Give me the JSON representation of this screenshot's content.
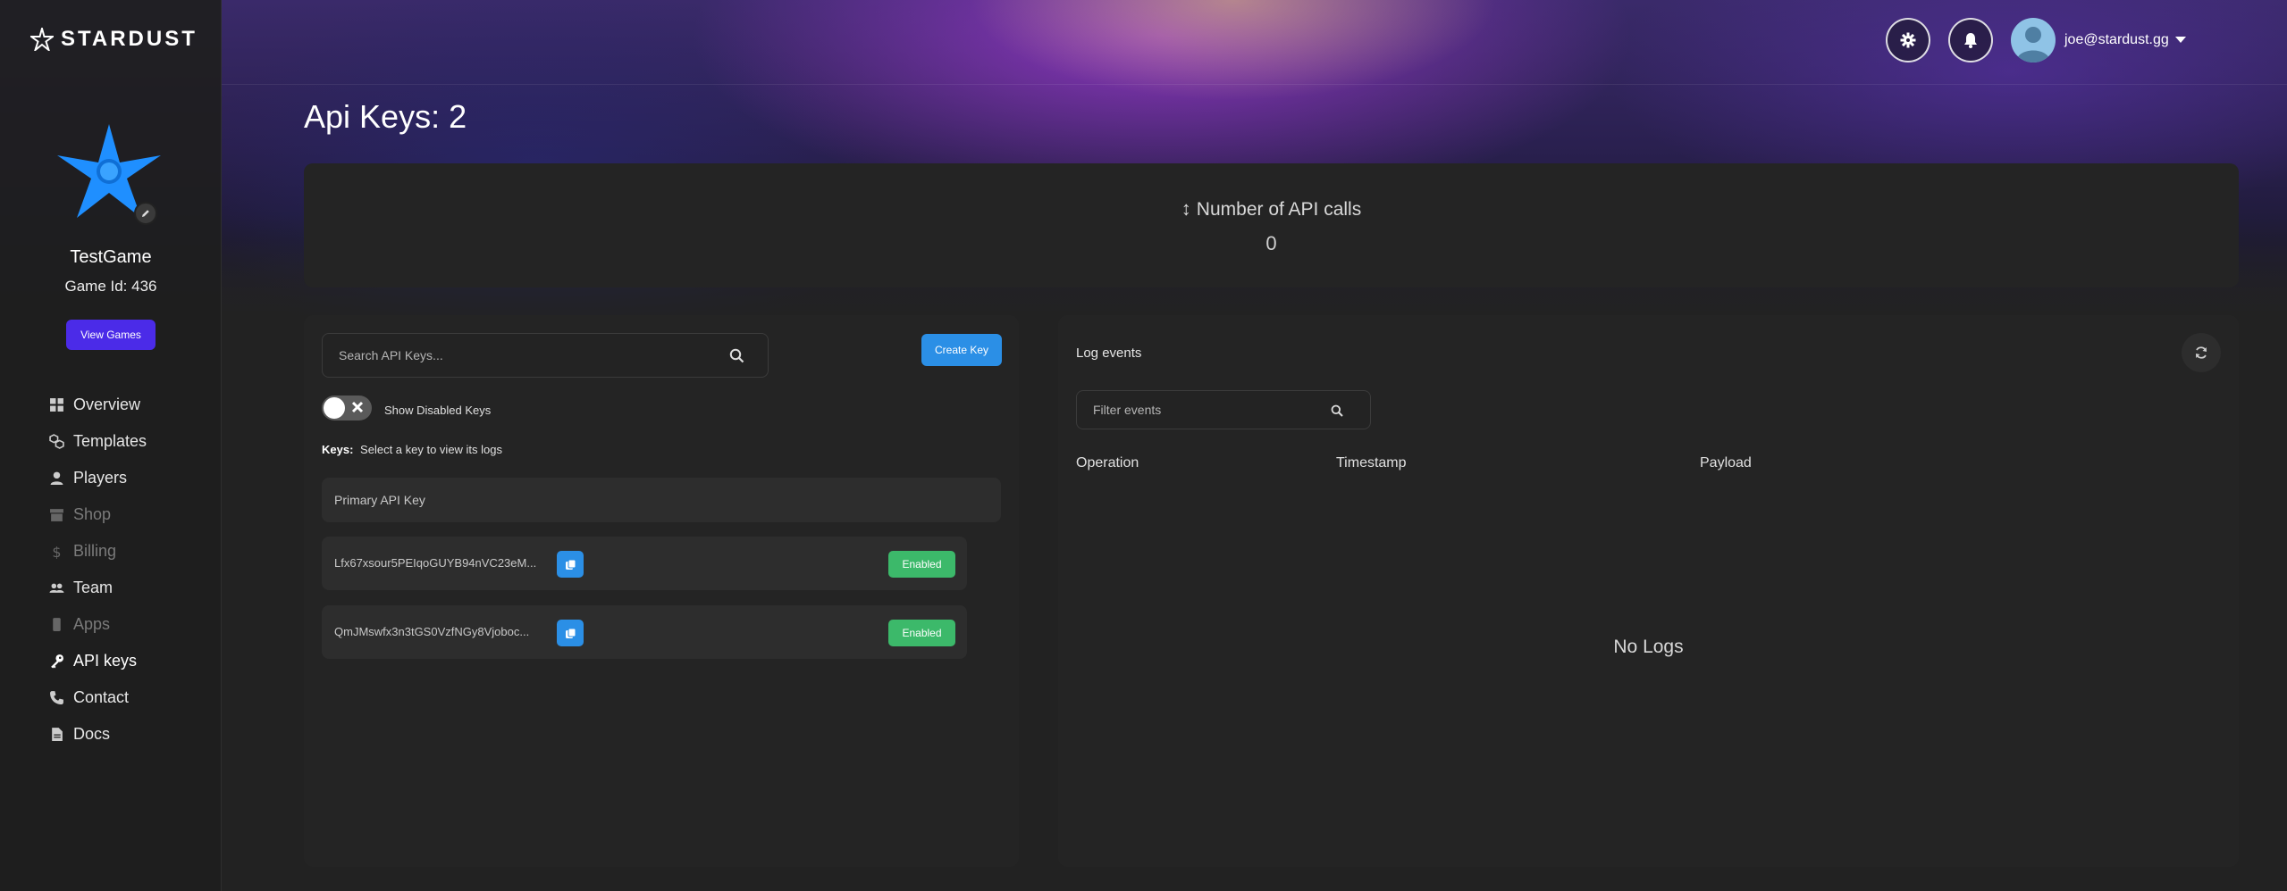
{
  "app": {
    "brand": "STARDUST",
    "brand_accent": "#4b2be8",
    "primary_blue": "#2b8fe6",
    "success_green": "#3cb96a"
  },
  "sidebar": {
    "game_name": "TestGame",
    "game_id": "Game Id: 436",
    "view_games_label": "View Games",
    "items": [
      {
        "label": "Overview",
        "icon": "grid-icon",
        "state": "normal"
      },
      {
        "label": "Templates",
        "icon": "cubes-icon",
        "state": "normal"
      },
      {
        "label": "Players",
        "icon": "user-icon",
        "state": "normal"
      },
      {
        "label": "Shop",
        "icon": "store-icon",
        "state": "disabled"
      },
      {
        "label": "Billing",
        "icon": "dollar-icon",
        "state": "disabled"
      },
      {
        "label": "Team",
        "icon": "users-icon",
        "state": "normal"
      },
      {
        "label": "Apps",
        "icon": "mobile-icon",
        "state": "disabled"
      },
      {
        "label": "API keys",
        "icon": "key-icon",
        "state": "active"
      },
      {
        "label": "Contact",
        "icon": "phone-icon",
        "state": "normal"
      },
      {
        "label": "Docs",
        "icon": "document-icon",
        "state": "normal"
      }
    ]
  },
  "header": {
    "user_email": "joe@stardust.gg"
  },
  "page": {
    "title": "Api Keys: 2"
  },
  "stats": {
    "label": "Number of API calls",
    "value": "0"
  },
  "keys_panel": {
    "search_placeholder": "Search API Keys...",
    "create_key_label": "Create Key",
    "toggle_label": "Show Disabled Keys",
    "toggle_on": false,
    "keys_heading": "Keys:",
    "keys_hint": "Select a key to view its logs",
    "primary_label": "Primary API Key",
    "keys": [
      {
        "value": "Lfx67xsour5PEIqoGUYB94nVC23eM...",
        "status": "Enabled"
      },
      {
        "value": "QmJMswfx3n3tGS0VzfNGy8Vjoboc...",
        "status": "Enabled"
      }
    ]
  },
  "logs_panel": {
    "title": "Log events",
    "filter_placeholder": "Filter events",
    "columns": [
      "Operation",
      "Timestamp",
      "Payload"
    ],
    "empty_text": "No Logs"
  }
}
